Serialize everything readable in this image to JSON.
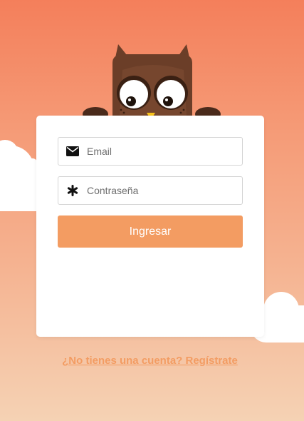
{
  "login": {
    "email_placeholder": "Email",
    "password_placeholder": "Contraseña",
    "submit_label": "Ingresar",
    "register_link": "¿No tienes una cuenta? Regístrate"
  },
  "icons": {
    "email": "envelope-icon",
    "password": "asterisk-icon"
  },
  "colors": {
    "background_top": "#f47f5b",
    "background_bottom": "#f5d2b4",
    "button": "#f39c62",
    "link": "#f39c62",
    "owl_body": "#6b3e28"
  }
}
